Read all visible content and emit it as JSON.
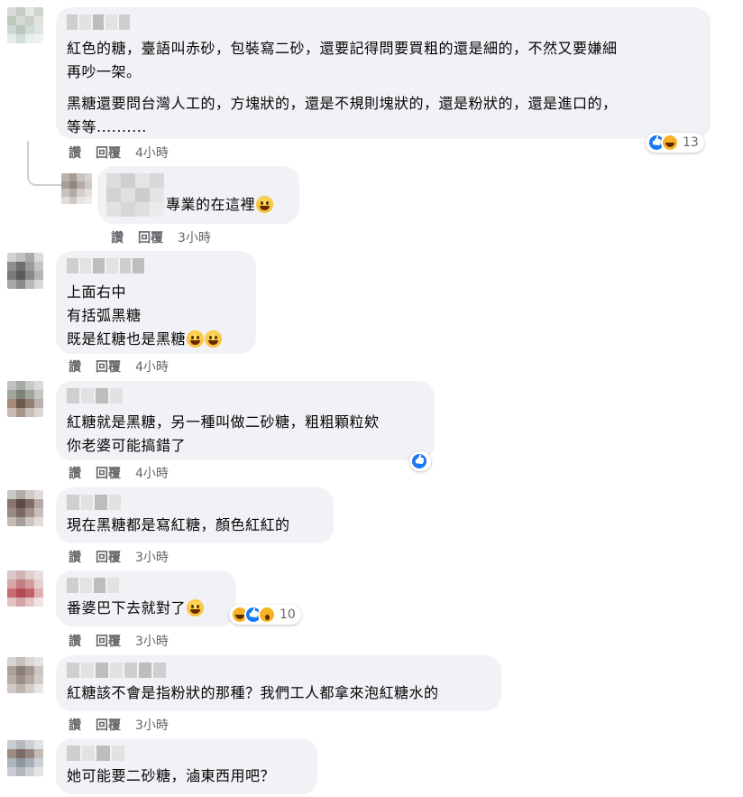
{
  "comments": [
    {
      "paragraphs": [
        "紅色的糖，臺語叫赤砂，包裝寫二砂，還要記得問要買粗的還是細的，不然又要嫌細",
        "再吵一架。",
        "黑糖還要問台灣人工的，方塊狀的，還是不規則塊狀的，還是粉狀的，還是進口的，",
        "等等.........."
      ],
      "actions": {
        "like": "讚",
        "reply": "回覆",
        "time": "4小時"
      },
      "reaction_count": "13"
    },
    {
      "text": "專業的在這裡",
      "actions": {
        "like": "讚",
        "reply": "回覆",
        "time": "3小時"
      }
    },
    {
      "lines": [
        "上面右中",
        "有括弧黑糖",
        "既是紅糖也是黑糖"
      ],
      "actions": {
        "like": "讚",
        "reply": "回覆",
        "time": "4小時"
      }
    },
    {
      "lines": [
        "紅糖就是黑糖，另一種叫做二砂糖，粗粗顆粒欸",
        "你老婆可能搞錯了"
      ],
      "actions": {
        "like": "讚",
        "reply": "回覆",
        "time": "4小時"
      }
    },
    {
      "text": "現在黑糖都是寫紅糖，顏色紅紅的",
      "actions": {
        "like": "讚",
        "reply": "回覆",
        "time": "3小時"
      }
    },
    {
      "text": "番婆巴下去就對了",
      "actions": {
        "like": "讚",
        "reply": "回覆",
        "time": "3小時"
      },
      "reaction_count": "10"
    },
    {
      "text": "紅糖該不會是指粉狀的那種？我們工人都拿來泡紅糖水的",
      "actions": {
        "like": "讚",
        "reply": "回覆",
        "time": "3小時"
      }
    },
    {
      "text": "她可能要二砂糖，滷東西用吧？"
    }
  ],
  "colors": {
    "bubble": "#f0f2f5",
    "like_blue": "#1877f2",
    "meta_gray": "#65676b"
  },
  "icons": {
    "like": "like-icon",
    "haha": "haha-icon",
    "wow": "wow-icon",
    "laugh_emoji": "grinning-face-emoji"
  }
}
